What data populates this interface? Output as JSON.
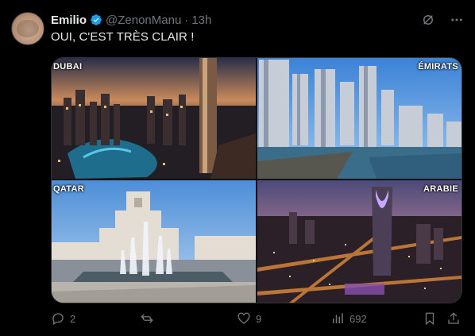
{
  "author": {
    "name": "Emilio",
    "handle": "@ZenonManu",
    "separator": "·",
    "time": "13h"
  },
  "text": "OUI, C'EST TRÈS CLAIR !",
  "media": {
    "tiles": [
      {
        "label": "DUBAI"
      },
      {
        "label": "ÉMIRATS"
      },
      {
        "label": "QATAR"
      },
      {
        "label": "ARABIE"
      }
    ]
  },
  "stats": {
    "replies": "2",
    "reposts": "",
    "likes": "9",
    "views": "692"
  },
  "colors": {
    "background": "#000000",
    "text": "#e7e9ea",
    "muted": "#71767b",
    "verified": "#1d9bf0"
  },
  "icons": [
    "verified-badge-icon",
    "grok-icon",
    "more-icon",
    "reply-icon",
    "repost-icon",
    "like-icon",
    "views-icon",
    "bookmark-icon",
    "share-icon"
  ]
}
